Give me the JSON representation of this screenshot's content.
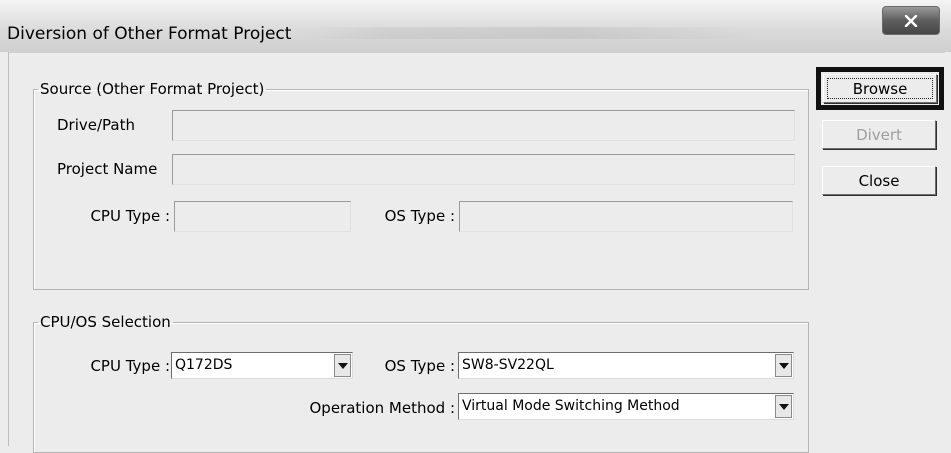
{
  "window": {
    "title": "Diversion of Other Format Project"
  },
  "source": {
    "group_label": "Source (Other Format Project)",
    "drive_path_label": "Drive/Path",
    "drive_path_value": "",
    "project_name_label": "Project Name",
    "project_name_value": "",
    "cpu_type_label": "CPU Type :",
    "cpu_type_value": "",
    "os_type_label": "OS Type :",
    "os_type_value": ""
  },
  "selection": {
    "group_label": "CPU/OS Selection",
    "cpu_type_label": "CPU Type :",
    "cpu_type_value": "Q172DS",
    "os_type_label": "OS Type :",
    "os_type_value": "SW8-SV22QL",
    "operation_method_label": "Operation Method :",
    "operation_method_value": "Virtual Mode Switching Method"
  },
  "buttons": {
    "browse": "Browse",
    "divert": "Divert",
    "close": "Close"
  },
  "colors": {
    "highlight_frame": "#111111",
    "disabled_text": "#9e9e9e"
  }
}
